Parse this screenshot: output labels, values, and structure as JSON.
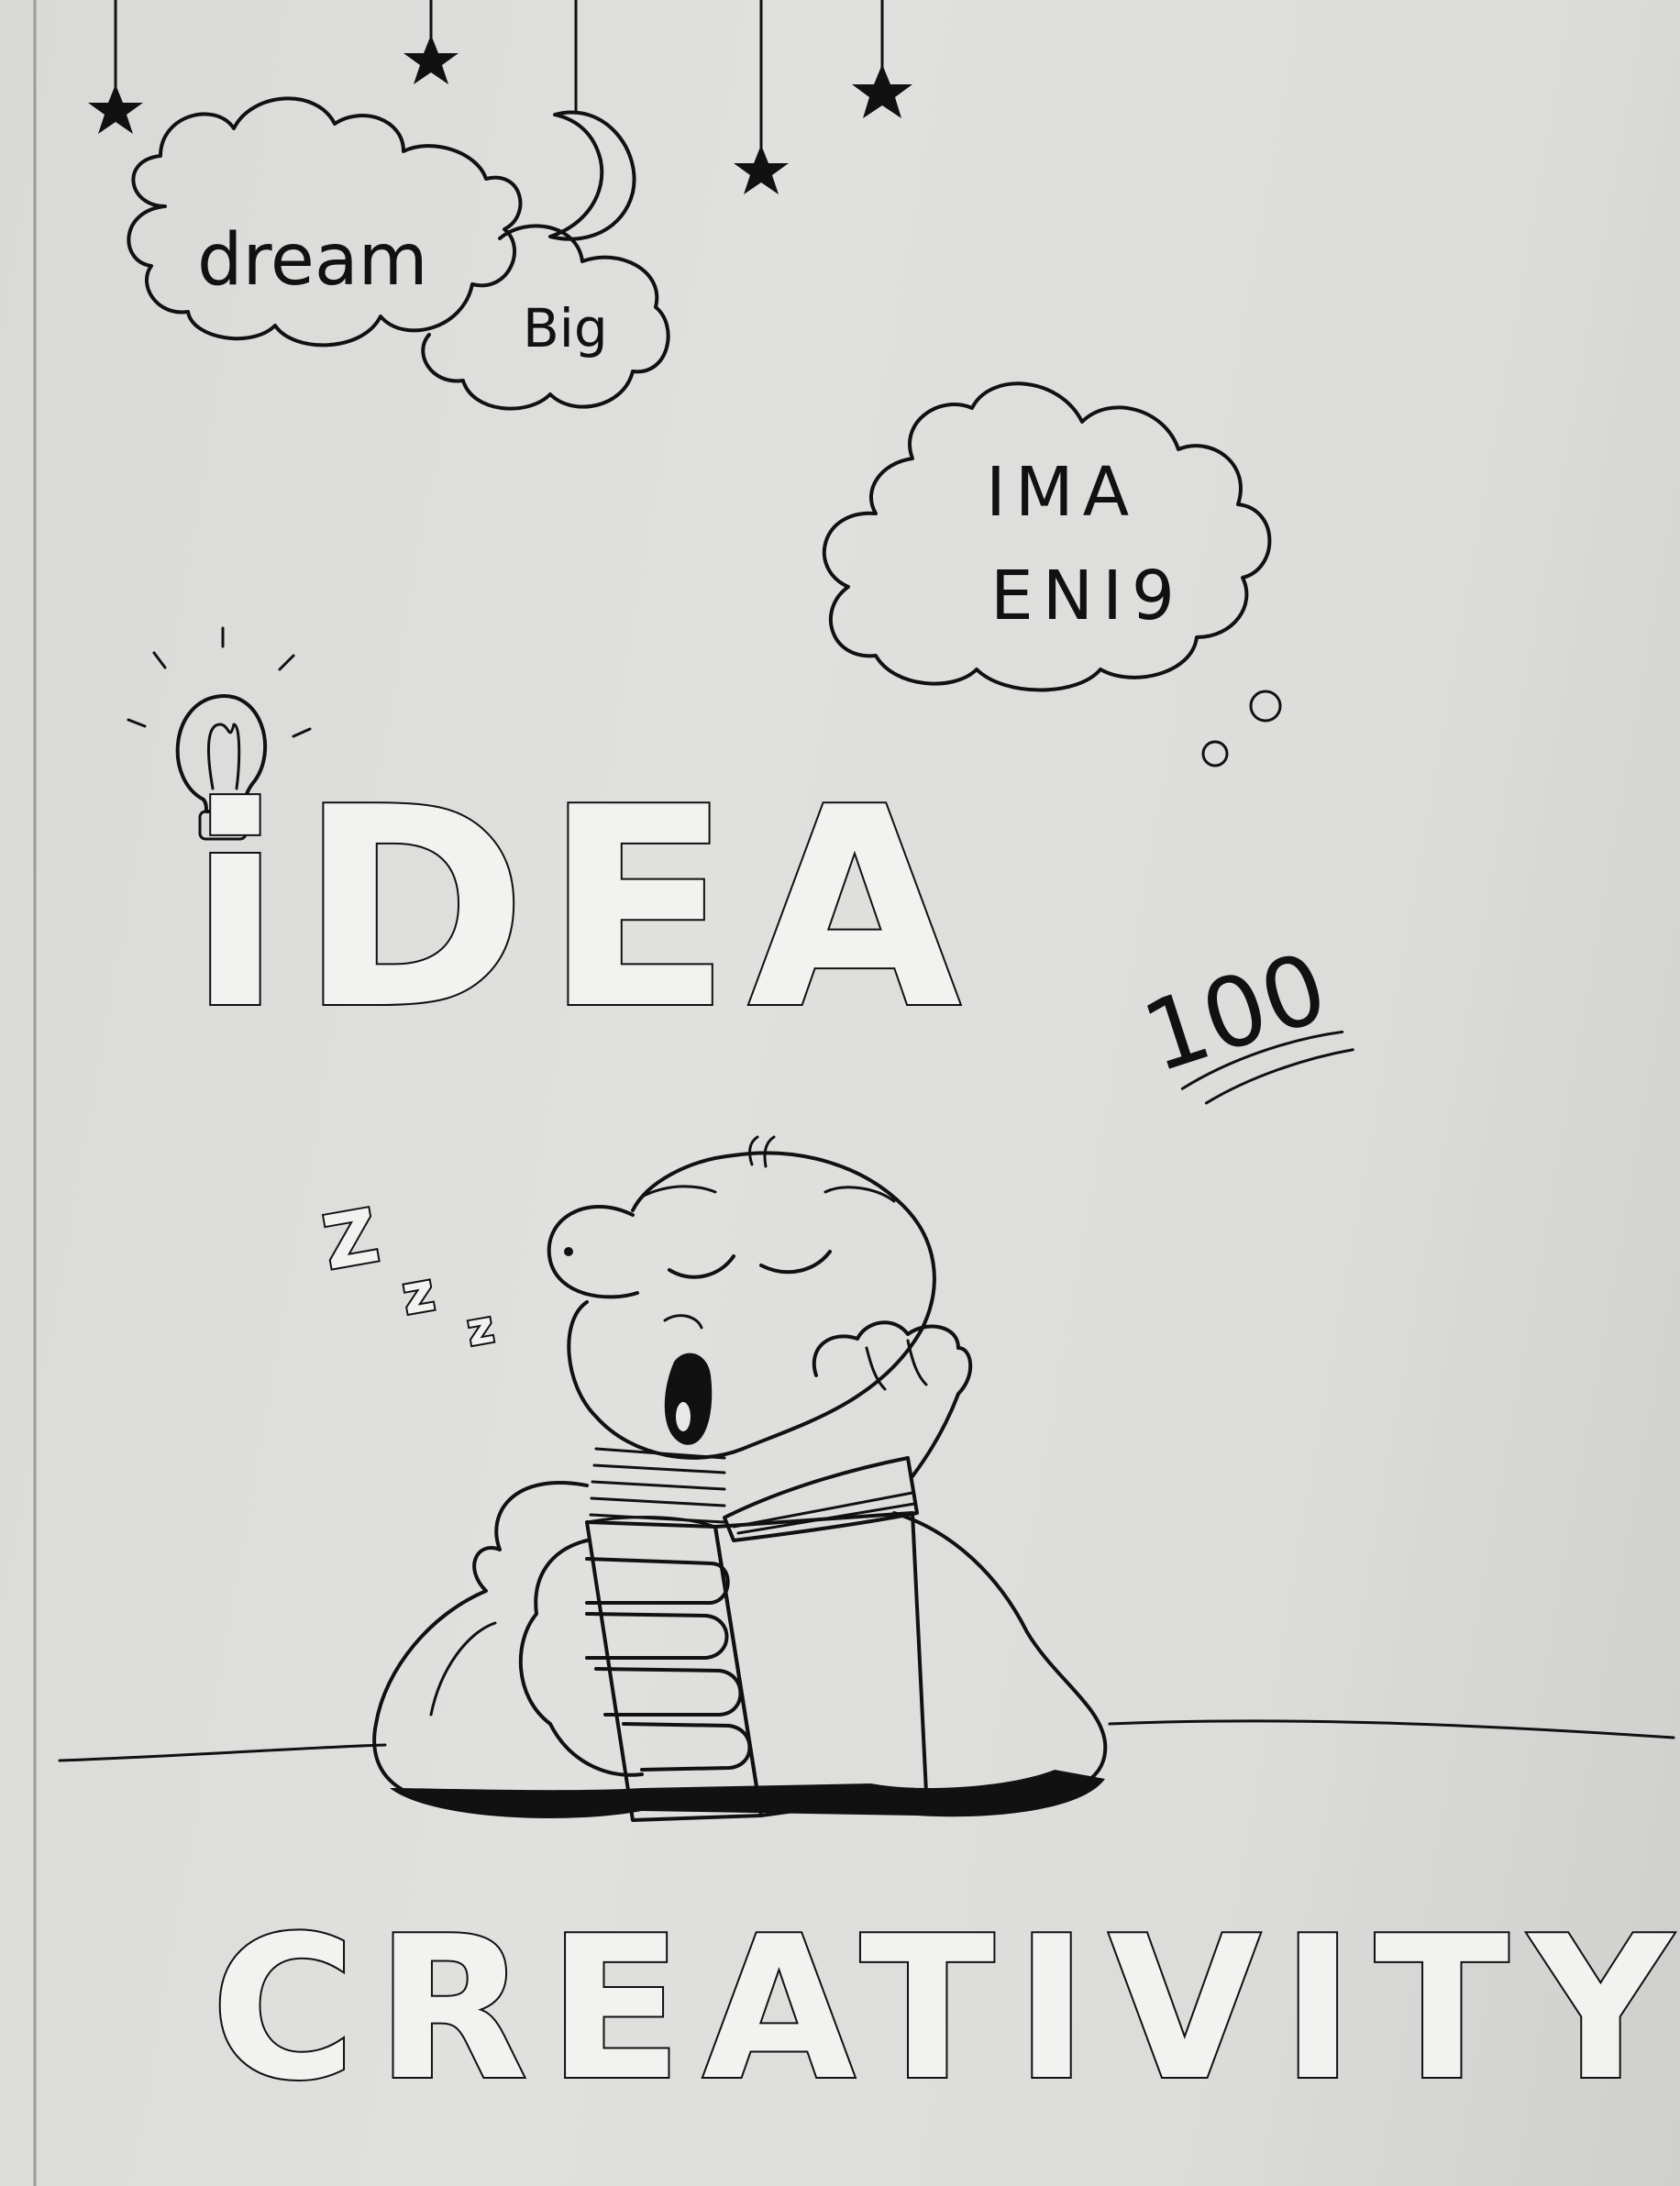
{
  "drawing": {
    "cloud_top_word1": "dream",
    "cloud_top_word2": "Big",
    "cloud_right_line1": "IMA",
    "cloud_right_line2": "ENI9",
    "idea_word": "iDEA",
    "score_text": "100",
    "snore_letters": [
      "Z",
      "z",
      "z"
    ],
    "bottom_word": "CREATIVITY"
  },
  "colors": {
    "paper": "#dddddb",
    "ink": "#111111"
  }
}
